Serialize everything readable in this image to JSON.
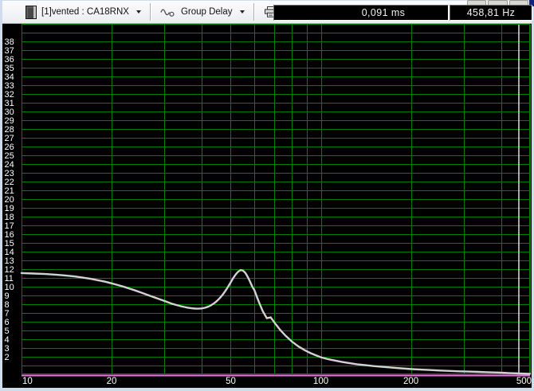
{
  "toolbar": {
    "project_selector_label": "[1]vented : CA18RNX",
    "plot_type_selector_label": "Group Delay",
    "print_label": "Print",
    "readout_delay": "0,091 ms",
    "readout_frequency": "458,81 Hz"
  },
  "chart_data": {
    "type": "line",
    "title": "Group Delay",
    "x_axis": {
      "scale": "log",
      "min": 10,
      "max": 500,
      "tick_labels": [
        10,
        20,
        50,
        100,
        200,
        500
      ],
      "gridlines": [
        10,
        20,
        30,
        40,
        50,
        60,
        70,
        80,
        90,
        100,
        200,
        300,
        400,
        500
      ]
    },
    "y_axis": {
      "min": 0,
      "max": 40,
      "gridline_step": 1,
      "labels": {
        "min": 2,
        "max": 38,
        "step": 1
      }
    },
    "grid_on": true,
    "colors": {
      "plot_background": "#000000",
      "grid": "#008000",
      "tick_text": "#ffffff",
      "curve": "#d2d2d2",
      "baseline": "#f56ef5",
      "cursor": "#ffffff"
    },
    "cursor": {
      "frequency_hz": 458.81,
      "value_ms": 0.091
    },
    "baseline": {
      "name": "zero-line",
      "value": 0
    },
    "series": [
      {
        "name": "[1]vented : CA18RNX",
        "points": [
          [
            10,
            11.55
          ],
          [
            11,
            11.5
          ],
          [
            12,
            11.45
          ],
          [
            13,
            11.37
          ],
          [
            14,
            11.28
          ],
          [
            15,
            11.17
          ],
          [
            16,
            11.04
          ],
          [
            17,
            10.9
          ],
          [
            18,
            10.74
          ],
          [
            19,
            10.57
          ],
          [
            20,
            10.38
          ],
          [
            21,
            10.18
          ],
          [
            22,
            9.98
          ],
          [
            23,
            9.77
          ],
          [
            24,
            9.56
          ],
          [
            25,
            9.35
          ],
          [
            26,
            9.14
          ],
          [
            27,
            8.94
          ],
          [
            28,
            8.74
          ],
          [
            29,
            8.55
          ],
          [
            30,
            8.37
          ],
          [
            31,
            8.19
          ],
          [
            32,
            8.03
          ],
          [
            33,
            7.9
          ],
          [
            34,
            7.78
          ],
          [
            35,
            7.68
          ],
          [
            36,
            7.6
          ],
          [
            37,
            7.54
          ],
          [
            38,
            7.5
          ],
          [
            39,
            7.49
          ],
          [
            40,
            7.52
          ],
          [
            41,
            7.59
          ],
          [
            42,
            7.71
          ],
          [
            43,
            7.88
          ],
          [
            44,
            8.1
          ],
          [
            45,
            8.38
          ],
          [
            46,
            8.71
          ],
          [
            47,
            9.09
          ],
          [
            48,
            9.52
          ],
          [
            49,
            10.0
          ],
          [
            50,
            10.5
          ],
          [
            51,
            11.0
          ],
          [
            52,
            11.42
          ],
          [
            53,
            11.73
          ],
          [
            54,
            11.9
          ],
          [
            55,
            11.83
          ],
          [
            56,
            11.55
          ],
          [
            57,
            11.12
          ],
          [
            58,
            10.58
          ],
          [
            59,
            10.0
          ],
          [
            60,
            9.6
          ],
          [
            62,
            8.3
          ],
          [
            64,
            7.2
          ],
          [
            66,
            6.4
          ],
          [
            68,
            6.5
          ],
          [
            70,
            5.9
          ],
          [
            73,
            5.1
          ],
          [
            76,
            4.45
          ],
          [
            80,
            3.75
          ],
          [
            84,
            3.2
          ],
          [
            88,
            2.78
          ],
          [
            92,
            2.45
          ],
          [
            96,
            2.18
          ],
          [
            100,
            1.95
          ],
          [
            106,
            1.72
          ],
          [
            112,
            1.55
          ],
          [
            118,
            1.4
          ],
          [
            125,
            1.26
          ],
          [
            132,
            1.15
          ],
          [
            140,
            1.05
          ],
          [
            150,
            0.94
          ],
          [
            160,
            0.85
          ],
          [
            172,
            0.76
          ],
          [
            185,
            0.68
          ],
          [
            200,
            0.6
          ],
          [
            215,
            0.54
          ],
          [
            230,
            0.49
          ],
          [
            250,
            0.43
          ],
          [
            270,
            0.38
          ],
          [
            290,
            0.34
          ],
          [
            310,
            0.31
          ],
          [
            335,
            0.27
          ],
          [
            360,
            0.24
          ],
          [
            390,
            0.2
          ],
          [
            420,
            0.15
          ],
          [
            440,
            0.12
          ],
          [
            458.81,
            0.091
          ],
          [
            480,
            0.07
          ],
          [
            500,
            0.055
          ]
        ]
      }
    ]
  }
}
